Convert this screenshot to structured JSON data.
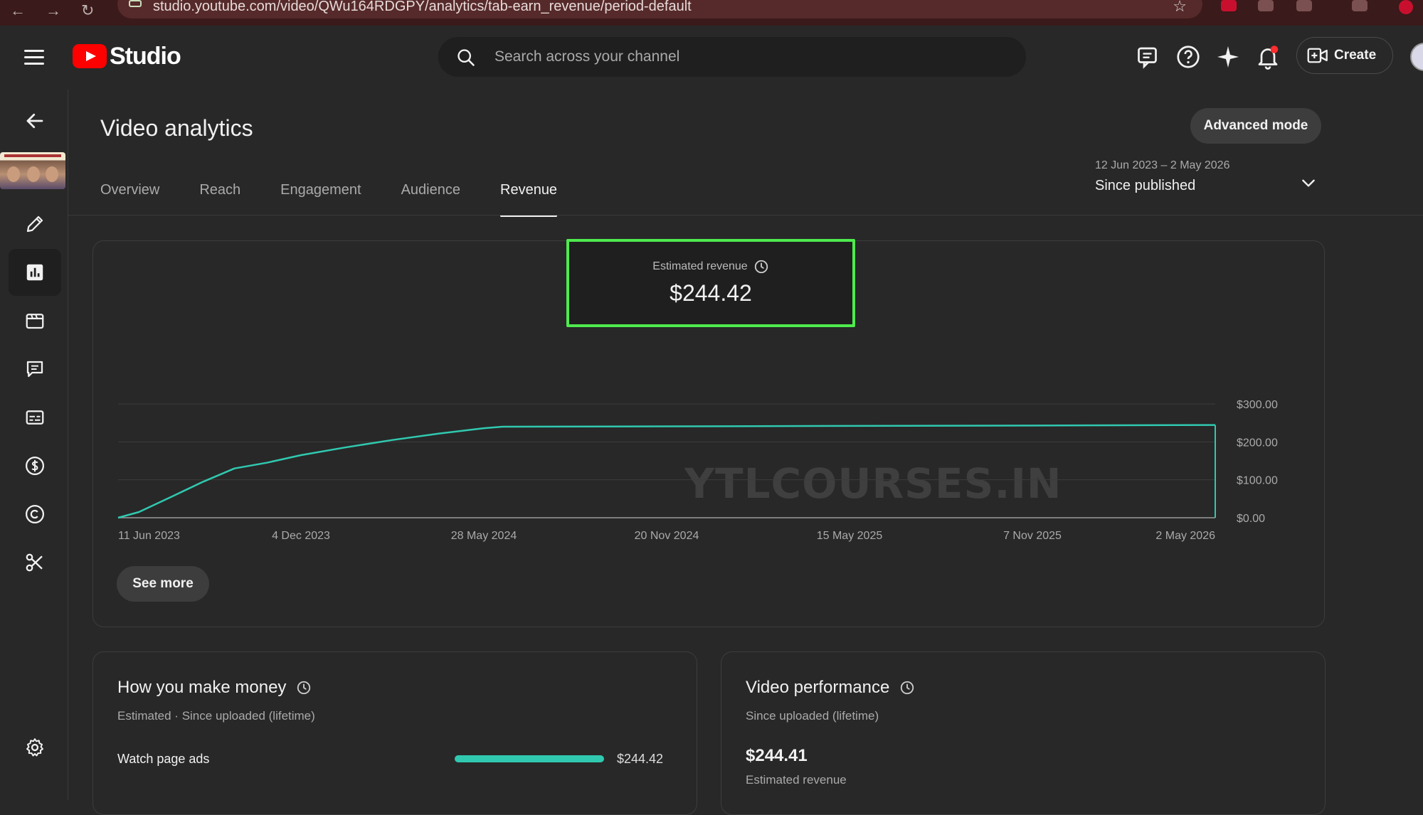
{
  "browser": {
    "url": "studio.youtube.com/video/QWu164RDGPY/analytics/tab-earn_revenue/period-default"
  },
  "header": {
    "app_name": "Studio",
    "search_placeholder": "Search across your channel",
    "create_label": "Create"
  },
  "sidebar": {
    "items": [
      {
        "name": "back",
        "icon": "arrow-left-icon"
      },
      {
        "name": "details",
        "icon": "pencil-icon"
      },
      {
        "name": "analytics",
        "icon": "analytics-icon",
        "active": true
      },
      {
        "name": "editor",
        "icon": "film-icon"
      },
      {
        "name": "comments",
        "icon": "comment-icon"
      },
      {
        "name": "subtitles",
        "icon": "subtitles-icon"
      },
      {
        "name": "earn",
        "icon": "dollar-icon"
      },
      {
        "name": "copyright",
        "icon": "copyright-icon"
      },
      {
        "name": "clips",
        "icon": "scissors-icon"
      },
      {
        "name": "settings",
        "icon": "gear-icon"
      }
    ]
  },
  "page": {
    "title": "Video analytics",
    "advanced_mode_label": "Advanced mode",
    "tabs": [
      {
        "label": "Overview"
      },
      {
        "label": "Reach"
      },
      {
        "label": "Engagement"
      },
      {
        "label": "Audience"
      },
      {
        "label": "Revenue",
        "active": true
      }
    ],
    "date_range": "12 Jun 2023 – 2 May 2026",
    "period": "Since published"
  },
  "metric": {
    "label": "Estimated revenue",
    "value": "$244.42"
  },
  "chart_data": {
    "type": "line",
    "x_ticks": [
      "11 Jun 2023",
      "4 Dec 2023",
      "28 May 2024",
      "20 Nov 2024",
      "15 May 2025",
      "7 Nov 2025",
      "2 May 2026"
    ],
    "y_ticks": [
      "$0.00",
      "$100.00",
      "$200.00",
      "$300.00"
    ],
    "ylim": [
      0,
      300
    ],
    "x": [
      "2023-06-11",
      "2023-07-01",
      "2023-08-01",
      "2023-09-01",
      "2023-10-01",
      "2023-11-01",
      "2023-12-04",
      "2024-01-15",
      "2024-03-01",
      "2024-04-15",
      "2024-05-28",
      "2024-06-15",
      "2024-11-20",
      "2025-05-15",
      "2025-11-07",
      "2026-05-02"
    ],
    "values": [
      0,
      15,
      55,
      95,
      130,
      145,
      165,
      185,
      205,
      222,
      236,
      240,
      241,
      242,
      243,
      244.42
    ],
    "line_color": "#30c9b0",
    "grid": true
  },
  "see_more_label": "See more",
  "watermark": "YTLCOURSES.IN",
  "money_card": {
    "title": "How you make money",
    "subtitle": "Estimated · Since uploaded (lifetime)",
    "rows": [
      {
        "label": "Watch page ads",
        "value": "$244.42",
        "fraction": 1.0
      }
    ]
  },
  "performance_card": {
    "title": "Video performance",
    "subtitle": "Since uploaded (lifetime)",
    "value": "$244.41",
    "value_label": "Estimated revenue"
  }
}
